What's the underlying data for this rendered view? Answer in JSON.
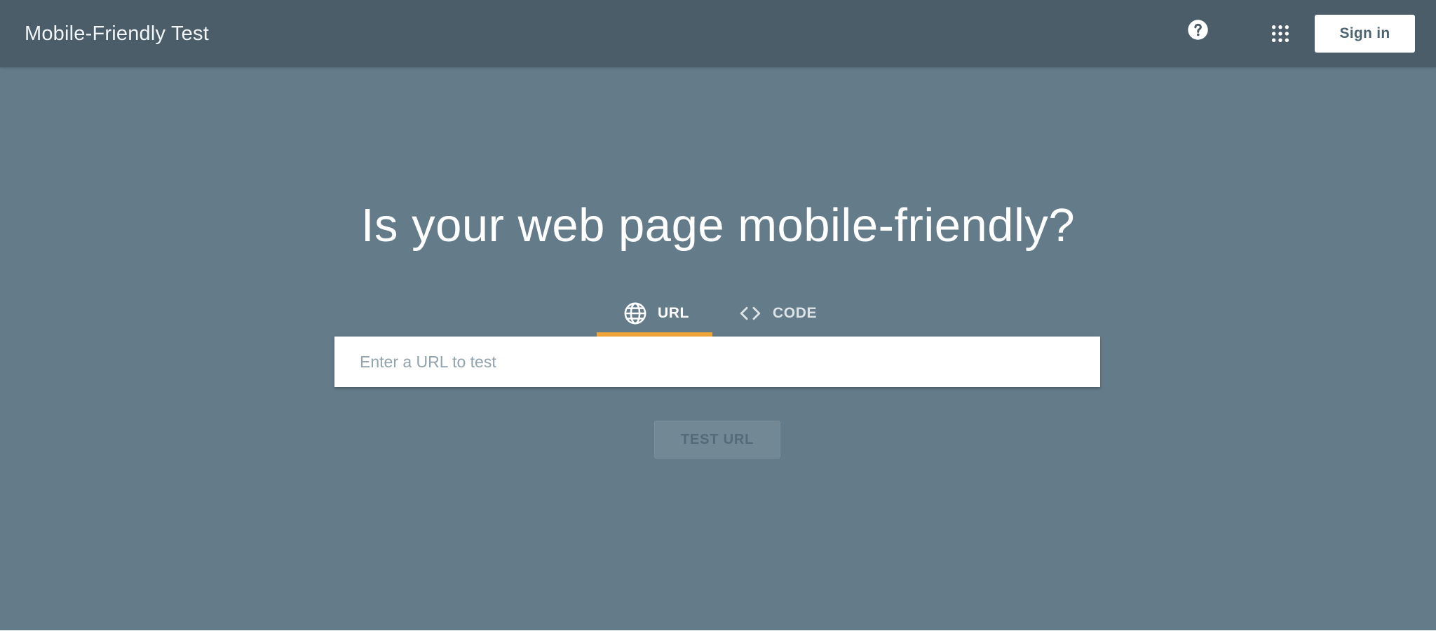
{
  "header": {
    "app_title": "Mobile-Friendly Test",
    "help_icon": "help-circle-icon",
    "apps_icon": "apps-grid-icon",
    "sign_in_label": "Sign in"
  },
  "main": {
    "headline": "Is your web page mobile-friendly?",
    "tabs": [
      {
        "label": "URL",
        "icon": "globe-icon",
        "selected": true
      },
      {
        "label": "CODE",
        "icon": "code-brackets-icon",
        "selected": false
      }
    ],
    "url_input": {
      "placeholder": "Enter a URL to test",
      "value": ""
    },
    "test_button_label": "TEST URL"
  },
  "colors": {
    "header_bg": "#4a5d68",
    "page_bg": "#647b89",
    "tab_indicator": "#f1a537",
    "test_button_bg": "#738895"
  }
}
